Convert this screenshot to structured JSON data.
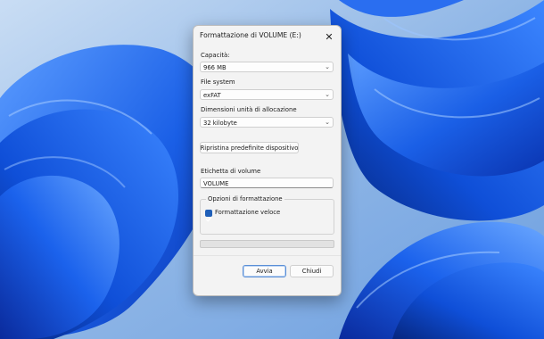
{
  "dialog": {
    "title": "Formattazione di VOLUME (E:)",
    "close_glyph": "✕",
    "capacity": {
      "label": "Capacità:",
      "value": "966 MB"
    },
    "file_system": {
      "label": "File system",
      "value": "exFAT"
    },
    "allocation": {
      "label": "Dimensioni unità di allocazione",
      "value": "32 kilobyte"
    },
    "restore_defaults_label": "Ripristina predefinite dispositivo",
    "volume_label": {
      "label": "Etichetta di volume",
      "value": "VOLUME"
    },
    "format_options": {
      "title": "Opzioni di formattazione",
      "quick_format_label": "Formattazione veloce",
      "quick_format_checked": true,
      "check_glyph": "✓"
    },
    "progress": 0,
    "start_label": "Avvia",
    "close_label": "Chiudi",
    "chevron_glyph": "⌄",
    "icons": {
      "close": "close-icon",
      "chevron": "chevron-down-icon",
      "check": "checkmark-icon"
    }
  },
  "colors": {
    "accent": "#1f5fb8",
    "dialog_bg": "#f3f3f3",
    "wallpaper_light": "#8fb6e6",
    "wallpaper_deep": "#0b3fc7",
    "wallpaper_mid": "#1f6cf0"
  }
}
